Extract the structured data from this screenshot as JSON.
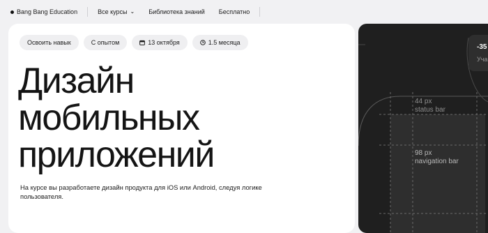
{
  "nav": {
    "brand": "Bang Bang Education",
    "all_courses": "Все курсы",
    "library": "Библиотека знаний",
    "free": "Бесплатно"
  },
  "chips": [
    "Освоить навык",
    "С опытом",
    "13 октября",
    "1.5 месяца"
  ],
  "hero": {
    "title_lines": [
      "Дизайн",
      "мобильных",
      "приложений"
    ],
    "description": "На курсе вы разработаете дизайн продукта для iOS или Android, следуя логике пользователя."
  },
  "illustration": {
    "stat_value": "-35",
    "stat_label": "Уча",
    "status_bar": {
      "size": "44 px",
      "label": "status bar"
    },
    "navigation_bar": {
      "size": "98 px",
      "label": "navigation bar"
    }
  }
}
